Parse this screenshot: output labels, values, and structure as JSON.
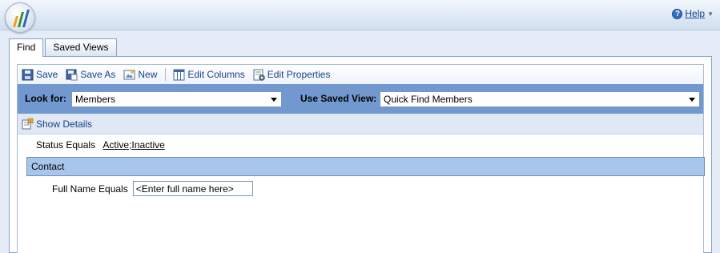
{
  "header": {
    "help_label": "Help",
    "help_icon": "?"
  },
  "tabs": [
    {
      "label": "Find",
      "active": true
    },
    {
      "label": "Saved Views",
      "active": false
    }
  ],
  "toolbar": {
    "save": "Save",
    "save_as": "Save As",
    "new": "New",
    "edit_columns": "Edit Columns",
    "edit_properties": "Edit Properties"
  },
  "lookbar": {
    "look_for_label": "Look for:",
    "look_for_value": "Members",
    "saved_view_label": "Use Saved View:",
    "saved_view_value": "Quick Find Members"
  },
  "details": {
    "show_details": "Show Details"
  },
  "criteria": {
    "status_label": "Status",
    "status_operator": "Equals",
    "status_value": "Active;Inactive",
    "group_label": "Contact",
    "fullname_label": "Full Name",
    "fullname_operator": "Equals",
    "fullname_value": "<Enter full name here>"
  },
  "colors": {
    "accent": "#15428b",
    "lookbar_bg": "#7199cf",
    "group_bg": "#a8c6ea"
  }
}
